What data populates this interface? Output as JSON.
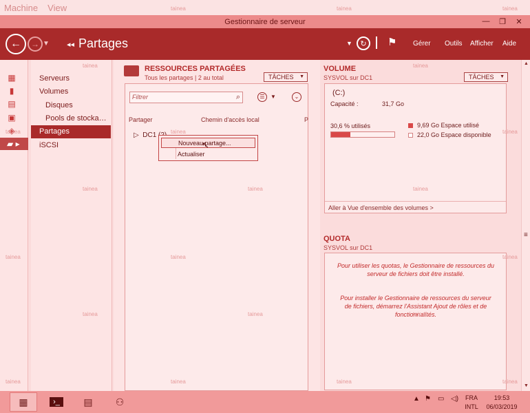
{
  "vm_menu": [
    "Machine",
    "View"
  ],
  "window": {
    "title": "Gestionnaire de serveur",
    "controls": [
      "—",
      "❐",
      "✕"
    ]
  },
  "header": {
    "breadcrumb": "Partages",
    "breadcrumb_arrows": "◂◂",
    "menus": [
      "Gérer",
      "Outils",
      "Afficher",
      "Aide"
    ]
  },
  "nav": {
    "items": [
      {
        "label": "Serveurs",
        "sub": false,
        "selected": false
      },
      {
        "label": "Volumes",
        "sub": false,
        "selected": false
      },
      {
        "label": "Disques",
        "sub": true,
        "selected": false
      },
      {
        "label": "Pools de stocka…",
        "sub": true,
        "selected": false
      },
      {
        "label": "Partages",
        "sub": false,
        "selected": true
      },
      {
        "label": "iSCSI",
        "sub": false,
        "selected": false
      }
    ]
  },
  "shares": {
    "title": "RESSOURCES PARTAGÉES",
    "subtitle": "Tous les partages | 2 au total",
    "tasks_label": "TÂCHES",
    "filter_placeholder": "Filtrer",
    "columns": [
      "Partager",
      "Chemin d'accès local",
      "P"
    ],
    "tree_row": "DC1 (2)"
  },
  "context_menu": {
    "items": [
      "Nouveau partage...",
      "Actualiser"
    ]
  },
  "volume": {
    "title": "VOLUME",
    "subtitle": "SYSVOL sur DC1",
    "tasks_label": "TÂCHES",
    "drive": "(C:)",
    "capacity_label": "Capacité :",
    "capacity_value": "31,7 Go",
    "used_pct_label": "30,6 % utilisés",
    "used_fraction": 0.306,
    "used_legend": "9,69 Go Espace utilisé",
    "free_legend": "22,0 Go Espace disponible",
    "link": "Aller à Vue d'ensemble des volumes >"
  },
  "quota": {
    "title": "QUOTA",
    "subtitle": "SYSVOL sur DC1",
    "msg1": "Pour utiliser les quotas, le Gestionnaire de ressources du serveur de fichiers doit être installé.",
    "msg2": "Pour installer le Gestionnaire de ressources du serveur de fichiers, démarrez l'Assistant Ajout de rôles et de fonctionnalités."
  },
  "taskbar": {
    "lang": "FRA",
    "layout": "INTL",
    "time": "19:53",
    "date": "06/03/2019"
  },
  "watermark": "tainea",
  "colors": {
    "accent": "#a92a2a",
    "used": "#d94848"
  }
}
